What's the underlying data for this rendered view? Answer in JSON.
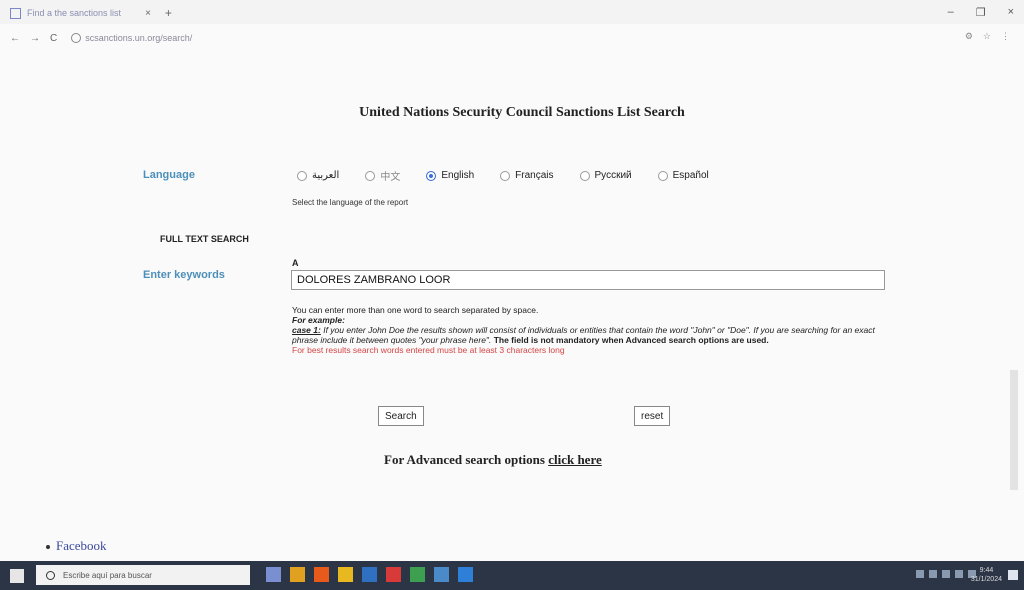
{
  "browser": {
    "tab_title": "Find a the sanctions list",
    "tab_close": "×",
    "tab_new": "+",
    "url": "scsanctions.un.org/search/",
    "nav": {
      "back": "←",
      "forward": "→",
      "reload": "C"
    },
    "window": {
      "minimize": "–",
      "maximize": "❐",
      "close": "×"
    },
    "right_icons": [
      "⚙",
      "☆",
      "⋮"
    ]
  },
  "page": {
    "title": "United Nations Security Council Sanctions List Search",
    "language_label": "Language",
    "languages": [
      {
        "label": "العربية",
        "selected": false
      },
      {
        "label": "中文",
        "selected": false
      },
      {
        "label": "English",
        "selected": true
      },
      {
        "label": "Français",
        "selected": false
      },
      {
        "label": "Русский",
        "selected": false
      },
      {
        "label": "Español",
        "selected": false
      }
    ],
    "language_hint": "Select the language of the report",
    "full_text_search": "FULL TEXT SEARCH",
    "enter_keywords": "Enter keywords",
    "field_letter": "A",
    "keyword_value": "DOLORES ZAMBRANO LOOR",
    "help_line1": "You can enter more than one word to search separated by space.",
    "help_example": "For example:",
    "help_case": "case 1:",
    "help_case_text": "If you enter John Doe the results shown will consist of individuals or entities that contain the word \"John\" or \"Doe\". If you are searching for an exact phrase include it between quotes \"your phrase here\".",
    "help_mandatory": "The field is not mandatory when Advanced search options are used.",
    "help_red": "For best results search words entered must be at least 3 characters long",
    "search_button": "Search",
    "reset_button": "reset",
    "advanced_text": "For Advanced search options",
    "advanced_link": "click here",
    "footer_link": "Facebook"
  },
  "taskbar": {
    "search_placeholder": "Escribe aquí para buscar",
    "clock_time": "9:44",
    "clock_date": "31/1/2024",
    "app_colors": [
      "#7a8fd0",
      "#e0a020",
      "#e85a1c",
      "#e8b820",
      "#3070c0",
      "#d83a3a",
      "#3ca050",
      "#4a8ac8",
      "#2d7fd8"
    ]
  }
}
